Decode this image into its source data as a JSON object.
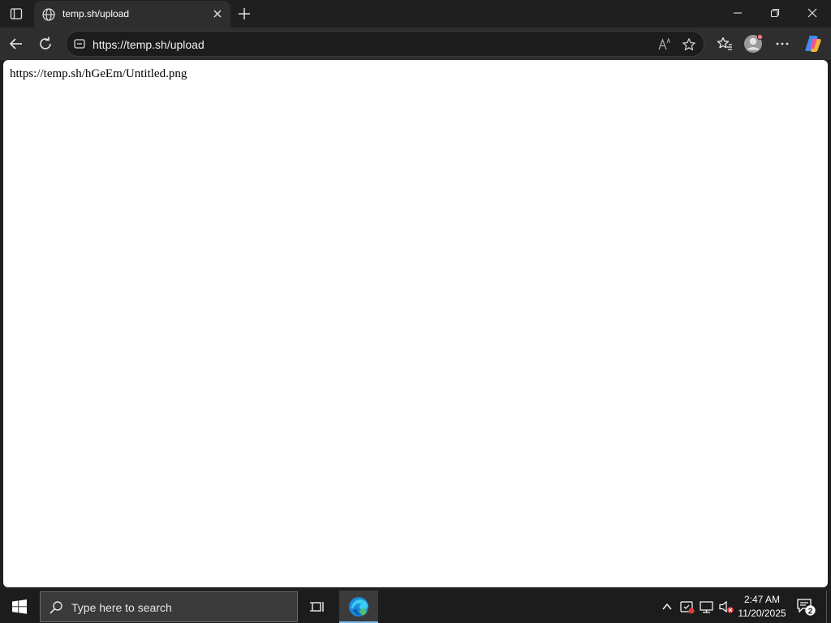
{
  "browser": {
    "tab": {
      "title": "temp.sh/upload",
      "favicon": "globe-icon"
    },
    "address_bar": {
      "url": "https://temp.sh/upload"
    }
  },
  "page": {
    "body_text": "https://temp.sh/hGeEm/Untitled.png"
  },
  "taskbar": {
    "search_placeholder": "Type here to search",
    "clock_time": "2:47 AM",
    "clock_date": "11/20/2025",
    "notification_count": "2"
  },
  "colors": {
    "accent": "#76b9ed",
    "chrome_dark": "#1f1f1f",
    "toolbar": "#2e2e2e"
  }
}
